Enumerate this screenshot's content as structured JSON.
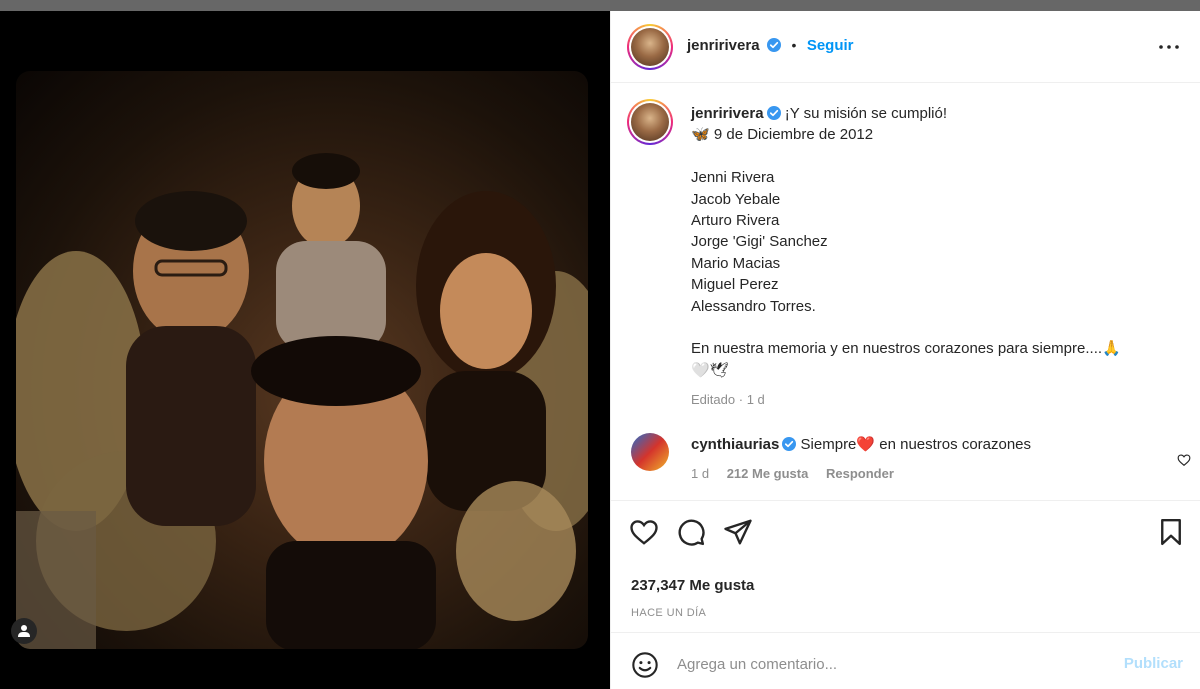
{
  "post": {
    "author": "jenririvera",
    "follow_label": "Seguir",
    "separator": "•",
    "more_icon": "more-options-icon"
  },
  "caption": {
    "author": "jenririvera",
    "lines": [
      "¡Y su misión se cumplió!",
      "🦋 9 de Diciembre de 2012",
      "",
      "Jenni Rivera",
      "Jacob Yebale",
      "Arturo Rivera",
      "Jorge 'Gigi' Sanchez",
      "Mario Macias",
      "Miguel Perez",
      "Alessandro Torres.",
      "",
      "En nuestra memoria y en nuestros corazones para siempre....🙏",
      "🤍🕊"
    ],
    "edited": "Editado",
    "dot": "·",
    "age": "1 d"
  },
  "comment": {
    "author": "cynthiaurias",
    "text_a": "Siempre",
    "heart": "❤️",
    "text_b": "en nuestros corazones",
    "age": "1 d",
    "likes": "212 Me gusta",
    "reply": "Responder"
  },
  "stats": {
    "likes": "237,347 Me gusta",
    "time": "HACE UN DÍA"
  },
  "composer": {
    "placeholder": "Agrega un comentario...",
    "publish": "Publicar"
  },
  "colors": {
    "accent": "#0095f6",
    "publish_disabled": "#b2dffc",
    "muted": "#8e8e8e",
    "text": "#262626",
    "verified": "#3897f0"
  }
}
